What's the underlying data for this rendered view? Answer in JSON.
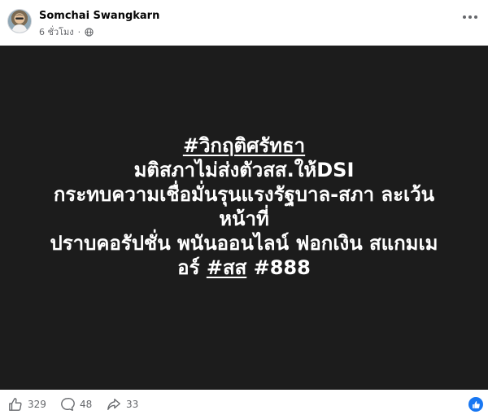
{
  "post": {
    "author": "Somchai Swangkarn",
    "time": "6 ชั่วโมง",
    "poster": {
      "line1": "#วิกฤติศรัทธา",
      "line2": "มติสภาไม่ส่งตัวสส.ให้DSI",
      "line3": "กระทบความเชื่อมั่นรุนแรงรัฐบาล-สภา ละเว้น",
      "line4": "หน้าที่",
      "line5": "ปราบคอรัปชั่น พนันออนไลน์ ฟอกเงิน สแกมเม",
      "line6_prefix": "อร์ ",
      "line6_tag1": "#สส",
      "line6_tag2": " #888"
    },
    "stats": {
      "likes": "329",
      "comments": "48",
      "shares": "33"
    }
  },
  "icons": {
    "globe": "globe-icon",
    "more": "more-options-icon",
    "like": "thumbs-up-icon",
    "comment": "comment-icon",
    "share": "share-icon",
    "reaction": "like-reaction-icon"
  },
  "colors": {
    "poster_bg": "#1c1c1c",
    "poster_text": "#ffffff",
    "meta_text": "#65676b",
    "accent": "#1877f2"
  }
}
